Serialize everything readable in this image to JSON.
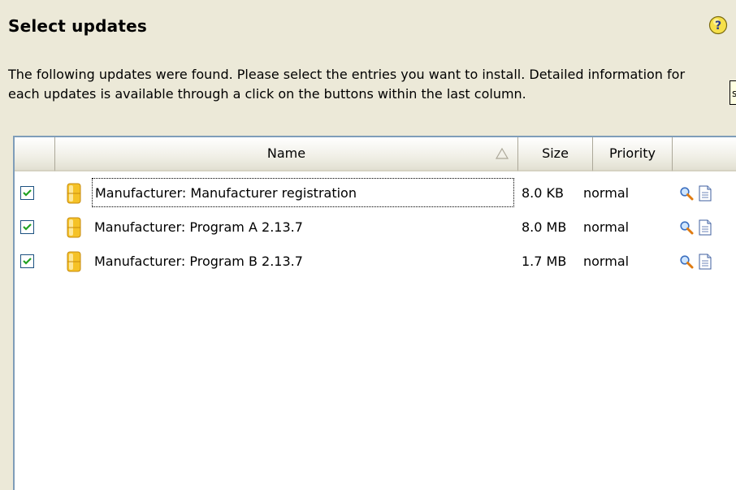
{
  "title": "Select updates",
  "description": "The following updates were found. Please select the entries you want to install. Detailed information for each updates is available through a click on the buttons within the last column.",
  "columns": {
    "checkbox": "",
    "name": "Name",
    "size": "Size",
    "priority": "Priority",
    "actions": ""
  },
  "sort": {
    "column": "Name",
    "direction": "ascending"
  },
  "rows": [
    {
      "checked": true,
      "name": "Manufacturer: Manufacturer registration",
      "size": "8.0 KB",
      "priority": "normal"
    },
    {
      "checked": true,
      "name": "Manufacturer: Program A  2.13.7",
      "size": "8.0 MB",
      "priority": "normal"
    },
    {
      "checked": true,
      "name": "Manufacturer: Program B 2.13.7",
      "size": "1.7 MB",
      "priority": "normal"
    }
  ],
  "icons": {
    "help": "help-icon",
    "package": "package-icon",
    "details": "magnifier-icon",
    "info": "document-icon"
  },
  "colors": {
    "panel_bg": "#ece9d8",
    "table_border": "#7f9db9",
    "checkbox_border": "#1c5180",
    "package_icon": "#f5c227"
  }
}
